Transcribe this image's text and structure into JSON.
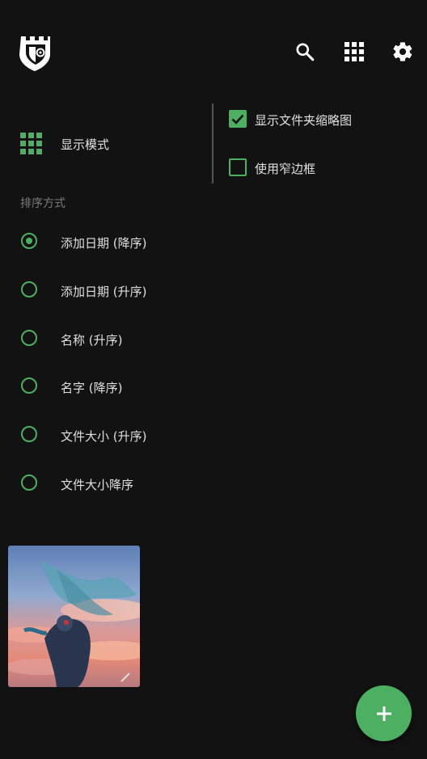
{
  "toolbar": {
    "logo_icon": "castle-shield-logo",
    "search_icon": "search-icon",
    "grid_icon": "grid-view-icon",
    "settings_icon": "gear-icon"
  },
  "view_options": {
    "display_mode_label": "显示模式",
    "show_folder_thumbnails_label": "显示文件夹缩略图",
    "show_folder_thumbnails_checked": true,
    "use_narrow_border_label": "使用窄边框",
    "use_narrow_border_checked": false
  },
  "sort": {
    "title": "排序方式",
    "options": [
      {
        "label": "添加日期 (降序)",
        "selected": true
      },
      {
        "label": "添加日期 (升序)",
        "selected": false
      },
      {
        "label": "名称 (升序)",
        "selected": false
      },
      {
        "label": "名字 (降序)",
        "selected": false
      },
      {
        "label": "文件大小 (升序)",
        "selected": false
      },
      {
        "label": "文件大小降序",
        "selected": false
      }
    ]
  },
  "fab": {
    "icon": "plus-icon"
  },
  "colors": {
    "accent": "#4caf62",
    "background": "#121212"
  }
}
